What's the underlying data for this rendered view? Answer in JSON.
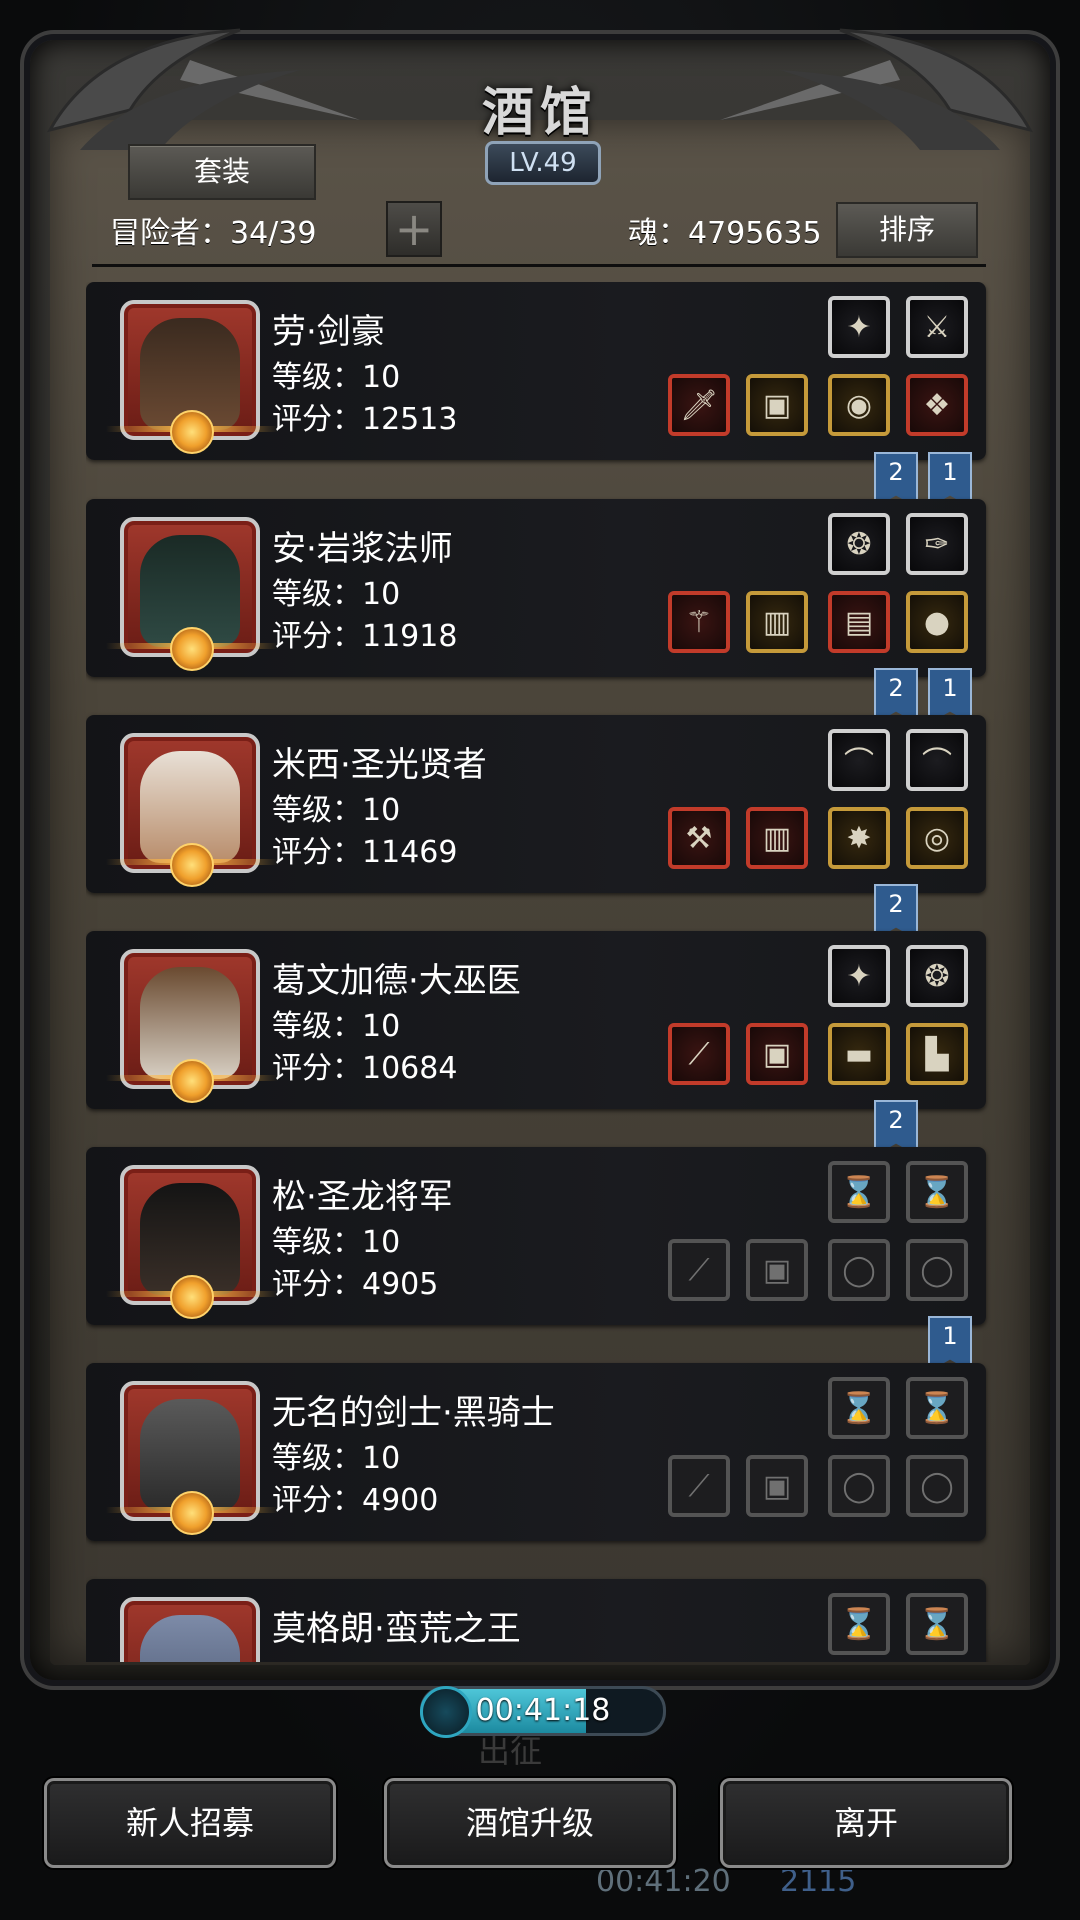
{
  "header": {
    "title": "酒馆",
    "level": "LV.49",
    "set_button": "套装",
    "adventurers_label": "冒险者：34/39",
    "add_symbol": "+",
    "soul_label": "魂：4795635",
    "sort_button": "排序"
  },
  "heroes": [
    {
      "name": "劳·剑豪",
      "level": "等级：10",
      "score": "评分：12513"
    },
    {
      "name": "安·岩浆法师",
      "level": "等级：10",
      "score": "评分：11918"
    },
    {
      "name": "米西·圣光贤者",
      "level": "等级：10",
      "score": "评分：11469"
    },
    {
      "name": "葛文加德·大巫医",
      "level": "等级：10",
      "score": "评分：10684"
    },
    {
      "name": "松·圣龙将军",
      "level": "等级：10",
      "score": "评分：4905"
    },
    {
      "name": "无名的剑士·黑骑士",
      "level": "等级：10",
      "score": "评分：4900"
    },
    {
      "name": "莫格朗·蛮荒之王",
      "level": "",
      "score": ""
    }
  ],
  "ribbons": [
    "2",
    "1",
    "2",
    "1",
    "2",
    "2",
    "1"
  ],
  "timer": "00:41:18",
  "background": {
    "behind_label": "出征",
    "behind_timer": "00:41:20",
    "behind_count": "2115"
  },
  "footer": {
    "recruit": "新人招募",
    "upgrade": "酒馆升级",
    "leave": "离开"
  },
  "colors": {
    "ribbon_blue": "#2f5b8e",
    "timer_fill": "#4ec6d8",
    "slot_red": "#c23b2a",
    "slot_gold": "#c59a3a"
  }
}
